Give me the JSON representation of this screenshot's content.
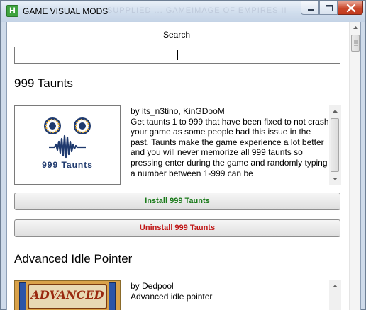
{
  "window": {
    "title": "GAME VISUAL MODS",
    "app_icon_letter": "H",
    "ghost_title": "SUPPLIED ... GAMEIMAGE OF EMPIRES II"
  },
  "search": {
    "label": "Search",
    "value": ""
  },
  "mods": [
    {
      "title": "999 Taunts",
      "author": "by its_n3tino, KinGDooM",
      "description": "Get taunts 1 to 999 that have been fixed to not crash your game as some people had this issue in the past. Taunts make the game experience a lot better and you will never memorize all 999 taunts so pressing enter during the game and randomly typing a number between 1-999 can be",
      "thumb_caption": "999 Taunts",
      "install_label": "Install 999 Taunts",
      "uninstall_label": "Uninstall 999 Taunts"
    },
    {
      "title": "Advanced Idle Pointer",
      "author": "by Dedpool",
      "description": "Advanced idle pointer",
      "thumb_caption": "ADVANCED"
    }
  ],
  "icons": {
    "minimize": "minimize-icon",
    "maximize": "maximize-icon",
    "close": "close-icon"
  },
  "colors": {
    "install": "#1a7a1a",
    "uninstall": "#c01818",
    "app_icon": "#3fa33f"
  }
}
